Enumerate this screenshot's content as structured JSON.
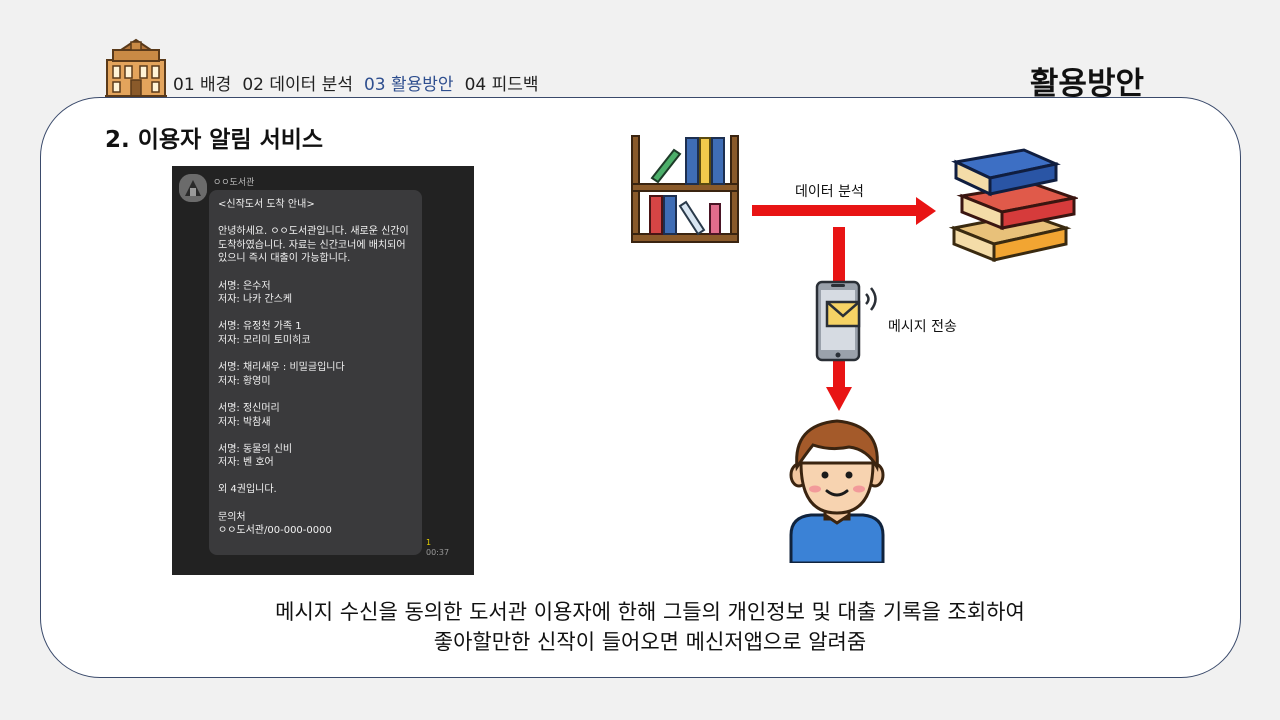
{
  "header": {
    "nav": [
      {
        "label": "01 배경",
        "active": false
      },
      {
        "label": "02 데이터 분석",
        "active": false
      },
      {
        "label": "03 활용방안",
        "active": true
      },
      {
        "label": "04 피드백",
        "active": false
      }
    ],
    "page_title": "활용방안"
  },
  "section": {
    "title": "2. 이용자 알림 서비스"
  },
  "chat": {
    "sender": "ㅇㅇ도서관",
    "message": "<신작도서 도착 안내>\n\n안녕하세요. ㅇㅇ도서관입니다. 새로운 신간이 도착하였습니다. 자료는 신간코너에 배치되어 있으니 즉시 대출이 가능합니다.\n\n서명: 은수저\n저자: 나카 간스케\n\n서명: 유정천 가족 1\n저자: 모리미 토미히코\n\n서명: 채리새우 : 비밀글입니다\n저자: 황영미\n\n서명: 정신머리\n저자: 박참새\n\n서명: 동물의 신비\n저자: 벤 호어\n\n외 4권입니다.\n\n문의처\nㅇㅇ도서관/00-000-0000",
    "read_count": "1",
    "time": "00:37"
  },
  "diagram": {
    "analysis_label": "데이터 분석",
    "send_label": "메시지 전송",
    "arrow_color": "#e81414",
    "icons": [
      "bookshelf-icon",
      "book-stack-icon",
      "phone-message-icon",
      "person-icon"
    ]
  },
  "caption": {
    "line1": "메시지 수신을 동의한 도서관 이용자에 한해 그들의 개인정보 및 대출 기록을 조회하여",
    "line2": "좋아할만한 신작이 들어오면 메신저앱으로 알려줌"
  }
}
